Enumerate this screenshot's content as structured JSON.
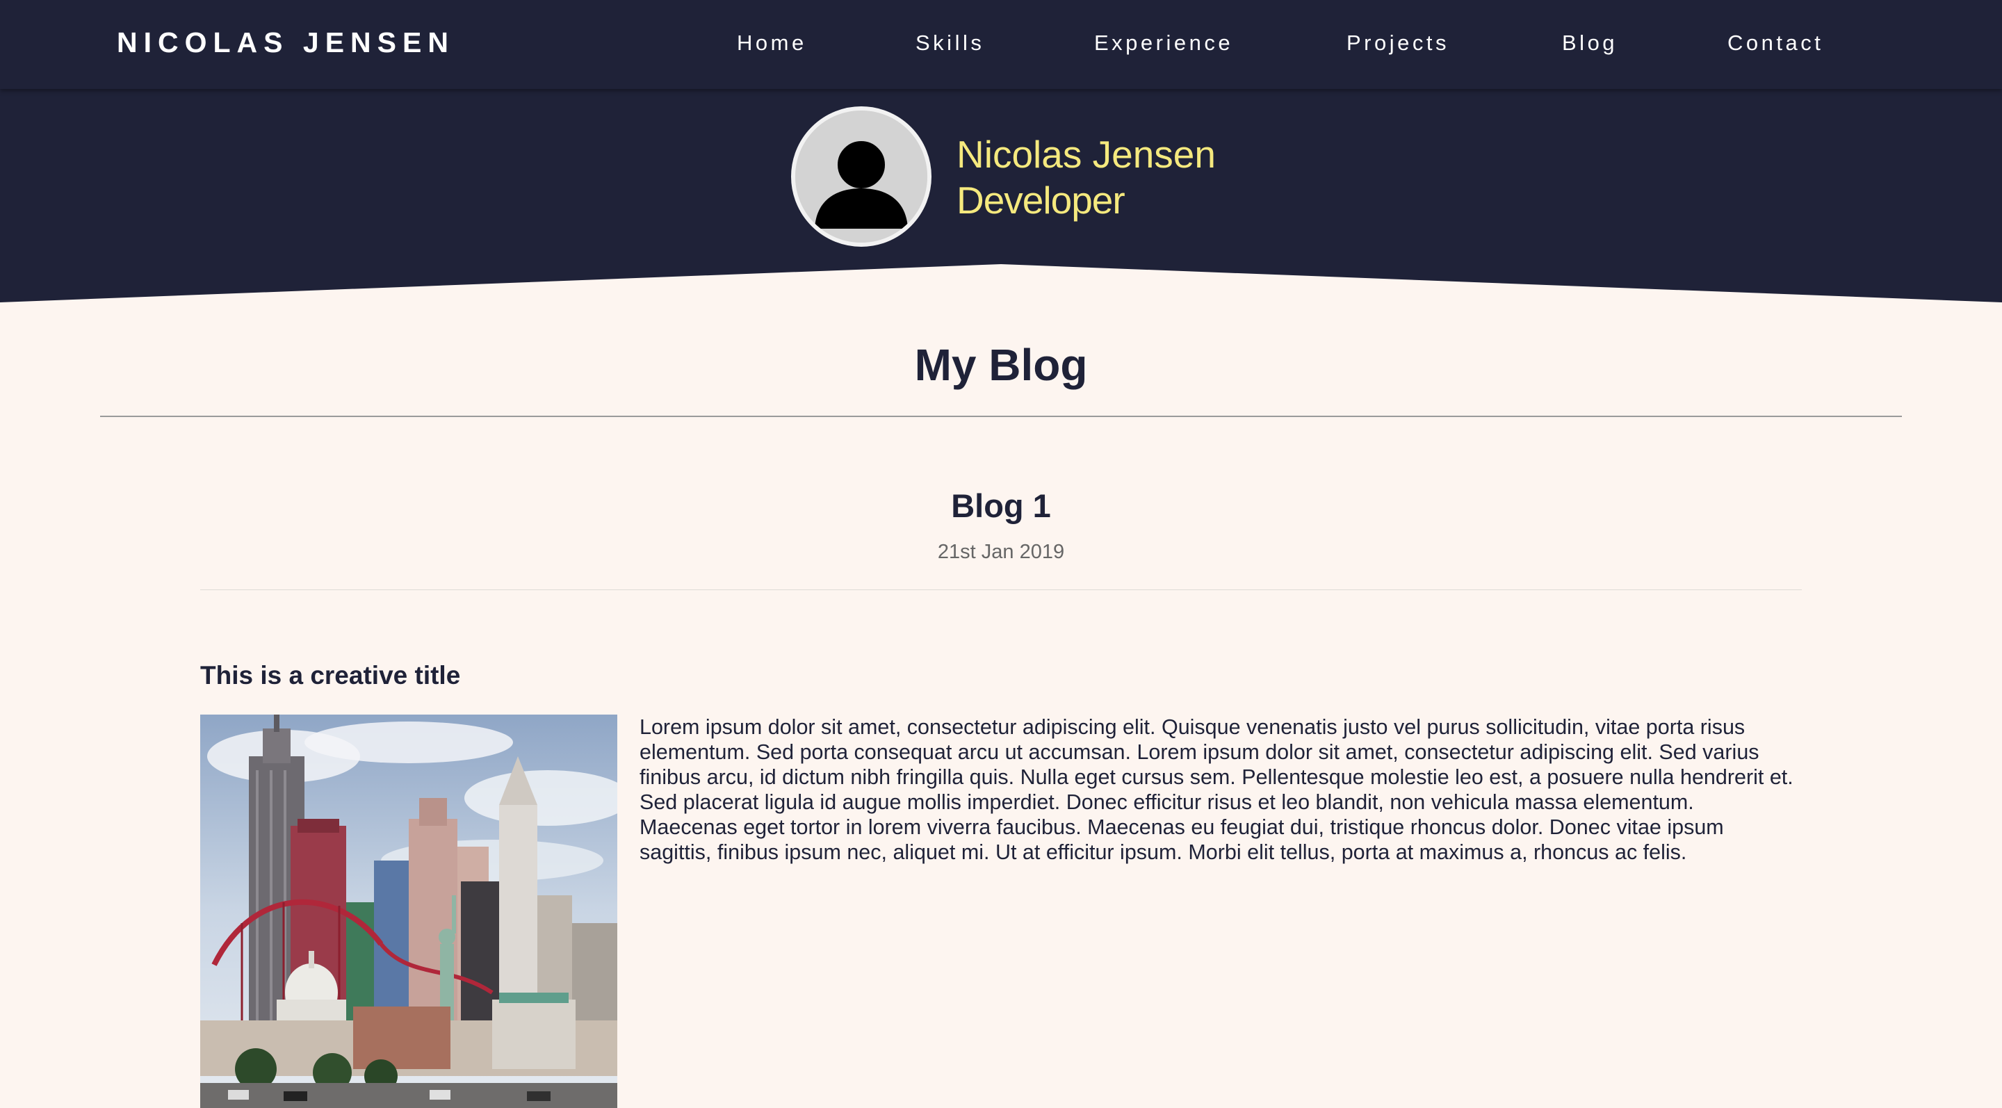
{
  "navbar": {
    "brand": "NICOLAS JENSEN",
    "links": [
      {
        "label": "Home"
      },
      {
        "label": "Skills"
      },
      {
        "label": "Experience"
      },
      {
        "label": "Projects"
      },
      {
        "label": "Blog"
      },
      {
        "label": "Contact"
      }
    ]
  },
  "hero": {
    "name": "Nicolas Jensen",
    "role": "Developer",
    "avatar_icon": "user-avatar-icon"
  },
  "main": {
    "page_title": "My Blog",
    "post": {
      "title": "Blog 1",
      "date": "21st Jan 2019",
      "heading": "This is a creative title",
      "image_subject": "city-skyline-photo",
      "body": "Lorem ipsum dolor sit amet, consectetur adipiscing elit. Quisque venenatis justo vel purus sollicitudin, vitae porta risus elementum. Sed porta consequat arcu ut accumsan. Lorem ipsum dolor sit amet, consectetur adipiscing elit. Sed varius finibus arcu, id dictum nibh fringilla quis. Nulla eget cursus sem. Pellentesque molestie leo est, a posuere nulla hendrerit et. Sed placerat ligula id augue mollis imperdiet. Donec efficitur risus et leo blandit, non vehicula massa elementum. Maecenas eget tortor in lorem viverra faucibus. Maecenas eu feugiat dui, tristique rhoncus dolor. Donec vitae ipsum sagittis, finibus ipsum nec, aliquet mi. Ut at efficitur ipsum. Morbi elit tellus, porta at maximus a, rhoncus ac felis."
    }
  },
  "colors": {
    "navy": "#1f2238",
    "accent_yellow": "#f5e97e",
    "page_background": "#fdf5f0"
  }
}
